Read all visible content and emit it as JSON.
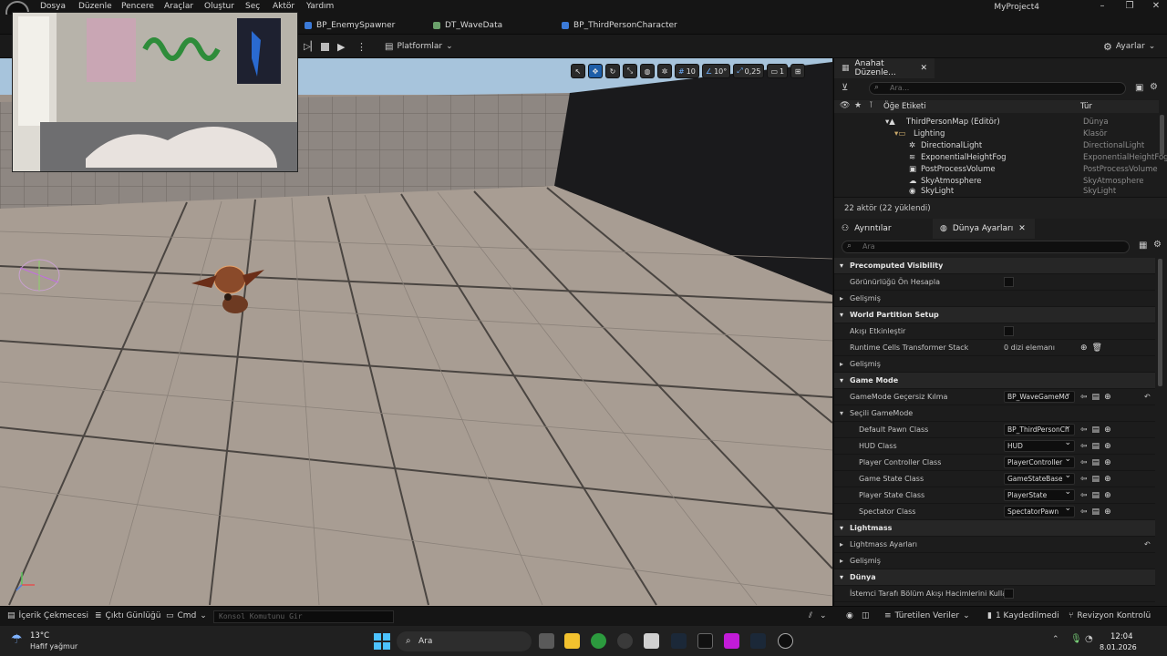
{
  "menubar": {
    "items": [
      "Dosya",
      "Düzenle",
      "Pencere",
      "Araçlar",
      "Oluştur",
      "Seç",
      "Aktör",
      "Yardım"
    ],
    "app_title": "MyProject4"
  },
  "tabs": [
    "BP_EnemySpawner",
    "DT_WaveData",
    "BP_ThirdPersonCharacter"
  ],
  "toolbar": {
    "platforms_label": "Platformlar",
    "settings_label": "Ayarlar"
  },
  "viewport": {
    "grid_value": "10",
    "angle_value": "10°",
    "scale_value": "0,25",
    "camera_value": "1"
  },
  "outliner": {
    "tab_label": "Anahat Düzenle...",
    "search_placeholder": "Ara...",
    "col_label": "Öğe Etiketi",
    "col_type": "Tür",
    "rows": [
      {
        "name": "ThirdPersonMap (Editör)",
        "type": "Dünya"
      },
      {
        "name": "Lighting",
        "type": "Klasör"
      },
      {
        "name": "DirectionalLight",
        "type": "DirectionalLight"
      },
      {
        "name": "ExponentialHeightFog",
        "type": "ExponentialHeightFog"
      },
      {
        "name": "PostProcessVolume",
        "type": "PostProcessVolume"
      },
      {
        "name": "SkyAtmosphere",
        "type": "SkyAtmosphere"
      },
      {
        "name": "SkyLight",
        "type": "SkyLight"
      }
    ],
    "footer": "22 aktör (22 yüklendi)"
  },
  "details": {
    "tab_details": "Ayrıntılar",
    "tab_world": "Dünya Ayarları",
    "search_placeholder": "Ara",
    "rows": [
      {
        "kind": "cat",
        "label": "Precomputed Visibility"
      },
      {
        "kind": "check",
        "label": "Görünürlüğü Ön Hesapla"
      },
      {
        "kind": "sub",
        "label": "Gelişmiş"
      },
      {
        "kind": "cat",
        "label": "World Partition Setup"
      },
      {
        "kind": "check",
        "label": "Akışı Etkinleştir"
      },
      {
        "kind": "text",
        "label": "Runtime Cells Transformer Stack",
        "value": "0 dizi elemanı"
      },
      {
        "kind": "sub",
        "label": "Gelişmiş"
      },
      {
        "kind": "cat",
        "label": "Game Mode"
      },
      {
        "kind": "dd",
        "label": "GameMode Geçersiz Kılma",
        "value": "BP_WaveGameMo"
      },
      {
        "kind": "sub",
        "label": "Seçili GameMode"
      },
      {
        "kind": "dd2",
        "label": "Default Pawn Class",
        "value": "BP_ThirdPersonCh"
      },
      {
        "kind": "dd2",
        "label": "HUD Class",
        "value": "HUD"
      },
      {
        "kind": "dd2",
        "label": "Player Controller Class",
        "value": "PlayerController"
      },
      {
        "kind": "dd2",
        "label": "Game State Class",
        "value": "GameStateBase"
      },
      {
        "kind": "dd2",
        "label": "Player State Class",
        "value": "PlayerState"
      },
      {
        "kind": "dd2",
        "label": "Spectator Class",
        "value": "SpectatorPawn"
      },
      {
        "kind": "cat",
        "label": "Lightmass"
      },
      {
        "kind": "sub",
        "label": "Lightmass Ayarları"
      },
      {
        "kind": "sub",
        "label": "Gelişmiş"
      },
      {
        "kind": "cat",
        "label": "Dünya"
      },
      {
        "kind": "check",
        "label": "İstemci Tarafı Bölüm Akışı Hacimlerini Kullan"
      }
    ]
  },
  "statusbar": {
    "content_drawer": "İçerik Çekmecesi",
    "output_log": "Çıktı Günlüğü",
    "cmd": "Cmd",
    "console_placeholder": "Konsol Komutunu Gir",
    "derived_data": "Türetilen Veriler",
    "unsaved": "1 Kaydedilmedi",
    "revision": "Revizyon Kontrolü"
  },
  "taskbar": {
    "temperature": "13°C",
    "weather": "Hafif yağmur",
    "search_label": "Ara",
    "time": "12:04",
    "date": "8.01.2026"
  },
  "colors": {
    "accent_blue": "#1e5ea8",
    "floor": "#a89d93",
    "wall": "#8c8580"
  }
}
